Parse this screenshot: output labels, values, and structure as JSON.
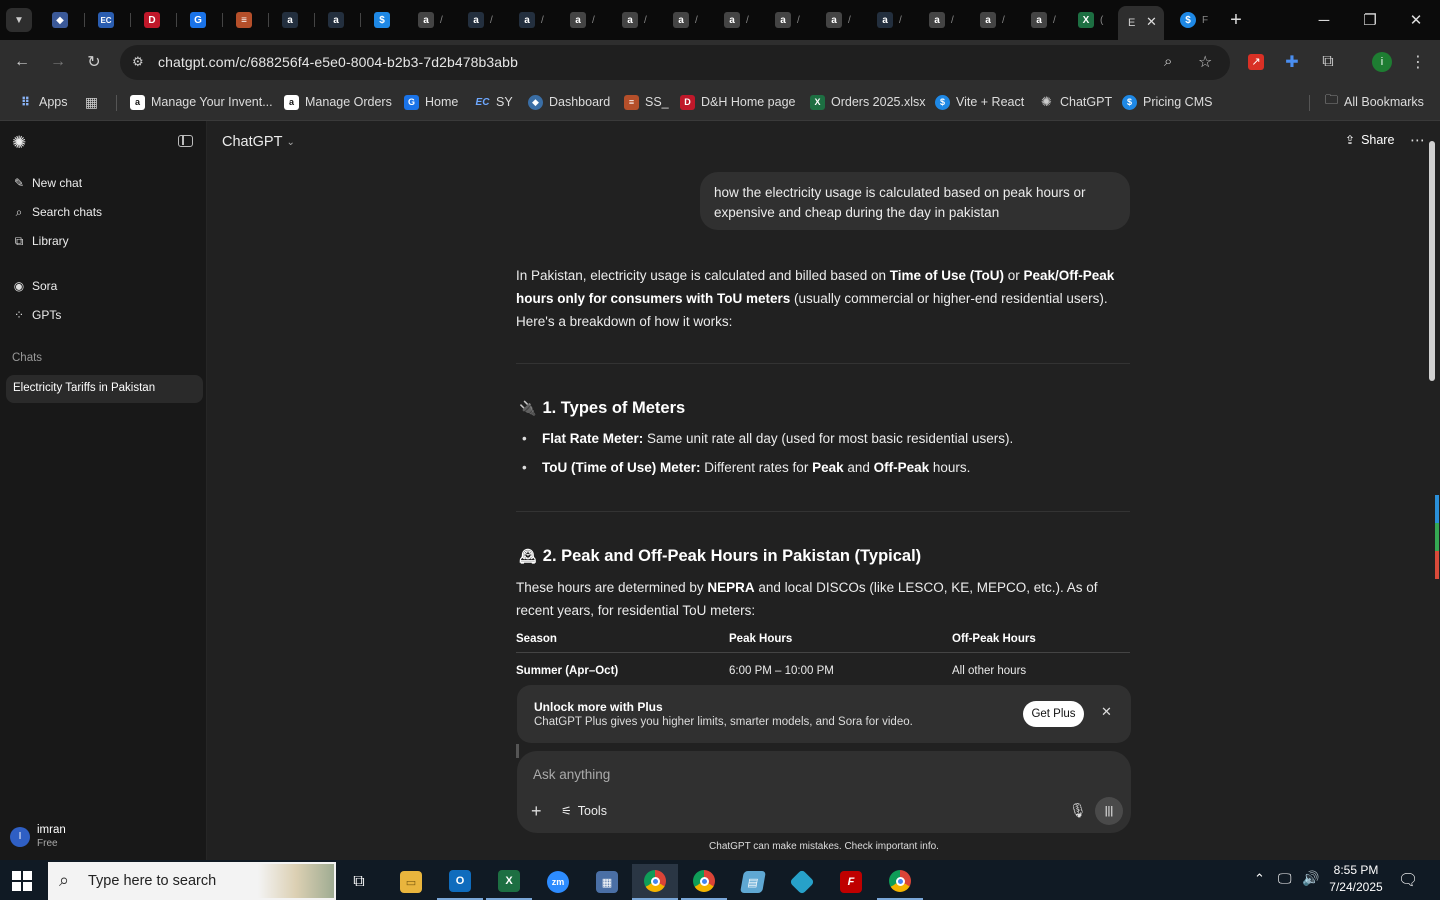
{
  "browser": {
    "url": "chatgpt.com/c/688256f4-e5e0-8004-b2b3-7d2b478b3abb",
    "tabs_marker": "F",
    "active_tab_letter": "E",
    "bookmarks": [
      {
        "label": "Apps",
        "color": "#4285f4",
        "glyph": "⋮⋮"
      },
      {
        "label": "",
        "color": "#555",
        "glyph": "▦"
      },
      {
        "label": "Manage Your Invent...",
        "color": "#232f3e",
        "glyph": "a"
      },
      {
        "label": "Manage Orders",
        "color": "#232f3e",
        "glyph": "a"
      },
      {
        "label": "Home",
        "color": "#1a73e8",
        "glyph": "G"
      },
      {
        "label": "SY",
        "color": "#2a5db0",
        "glyph": "EC"
      },
      {
        "label": "Dashboard",
        "color": "#3b5998",
        "glyph": "◆"
      },
      {
        "label": "SS_",
        "color": "#b54f2a",
        "glyph": "≡"
      },
      {
        "label": "D&H Home page",
        "color": "#c0182a",
        "glyph": "D"
      },
      {
        "label": "Orders 2025.xlsx",
        "color": "#1d6f42",
        "glyph": "X"
      },
      {
        "label": "Vite + React",
        "color": "#1e88e5",
        "glyph": "$"
      },
      {
        "label": "ChatGPT",
        "color": "#555",
        "glyph": "✺"
      },
      {
        "label": "Pricing CMS",
        "color": "#1e88e5",
        "glyph": "$"
      }
    ],
    "all_bookmarks": "All Bookmarks"
  },
  "sidebar": {
    "new_chat": "New chat",
    "search_chats": "Search chats",
    "library": "Library",
    "sora": "Sora",
    "gpts": "GPTs",
    "chats_heading": "Chats",
    "active_chat": "Electricity Tariffs in Pakistan",
    "user_name": "imran",
    "user_plan": "Free",
    "user_initial": "I"
  },
  "header": {
    "model": "ChatGPT",
    "share": "Share"
  },
  "conversation": {
    "user_message": "how the electricity usage is calculated based on peak hours or expensive and cheap during the day in pakistan",
    "intro_1": "In Pakistan, electricity usage is calculated and billed based on ",
    "intro_b1": "Time of Use (ToU)",
    "intro_2": " or ",
    "intro_b2": "Peak/Off-Peak hours only for consumers with ToU meters",
    "intro_3": " (usually commercial or higher-end residential users). Here's a breakdown of how it works:",
    "h1": "1. Types of Meters",
    "b1_bold": "Flat Rate Meter:",
    "b1_text": " Same unit rate all day (used for most basic residential users).",
    "b2_bold": "ToU (Time of Use) Meter:",
    "b2_text_1": " Different rates for ",
    "b2_b2": "Peak",
    "b2_text_2": " and ",
    "b2_b3": "Off-Peak",
    "b2_text_3": " hours.",
    "h2": "2. Peak and Off-Peak Hours in Pakistan (Typical)",
    "p2_1": "These hours are determined by ",
    "p2_b": "NEPRA",
    "p2_2": " and local DISCOs (like LESCO, KE, MEPCO, etc.). As of recent years, for residential ToU meters:",
    "table": {
      "headers": [
        "Season",
        "Peak Hours",
        "Off-Peak Hours"
      ],
      "rows": [
        [
          "Summer (Apr–Oct)",
          "6:00 PM – 10:00 PM",
          "All other hours"
        ]
      ]
    }
  },
  "upsell": {
    "title": "Unlock more with Plus",
    "text": "ChatGPT Plus gives you higher limits, smarter models, and Sora for video.",
    "button": "Get Plus"
  },
  "composer": {
    "placeholder": "Ask anything",
    "tools": "Tools",
    "disclaimer": "ChatGPT can make mistakes. Check important info."
  },
  "taskbar": {
    "search_placeholder": "Type here to search",
    "time": "8:55 PM",
    "date": "7/24/2025"
  }
}
